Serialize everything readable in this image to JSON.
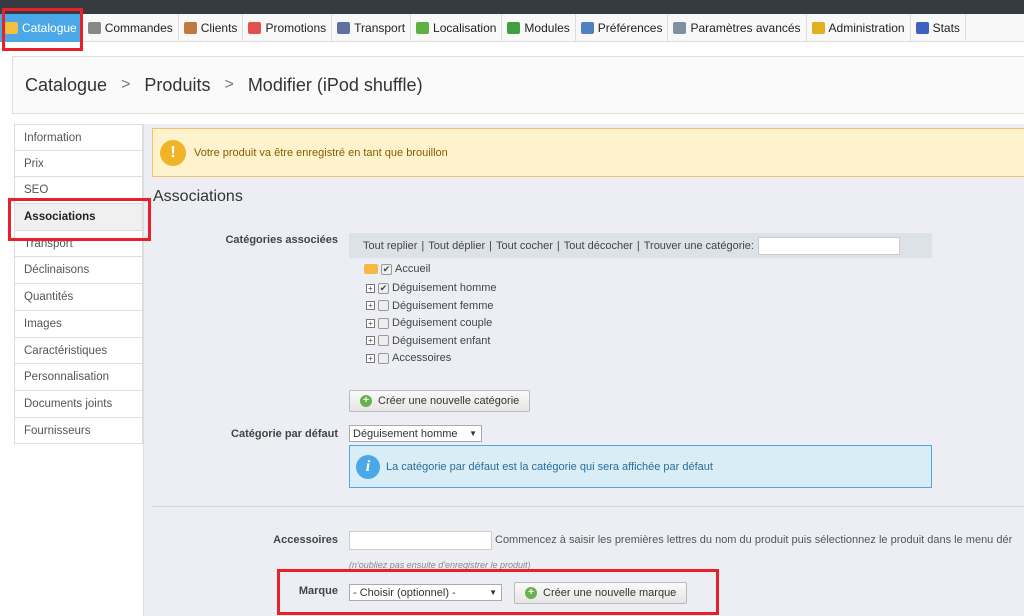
{
  "nav": {
    "tabs": [
      {
        "label": "Catalogue",
        "icon": "folder-icon",
        "color": "#f0c040",
        "active": true
      },
      {
        "label": "Commandes",
        "icon": "cart-icon",
        "color": "#888888"
      },
      {
        "label": "Clients",
        "icon": "user-icon",
        "color": "#c07a40"
      },
      {
        "label": "Promotions",
        "icon": "promotion-icon",
        "color": "#e05050"
      },
      {
        "label": "Transport",
        "icon": "truck-icon",
        "color": "#6070a0"
      },
      {
        "label": "Localisation",
        "icon": "globe-icon",
        "color": "#60b040"
      },
      {
        "label": "Modules",
        "icon": "puzzle-icon",
        "color": "#40a040"
      },
      {
        "label": "Préférences",
        "icon": "preferences-icon",
        "color": "#5080c0"
      },
      {
        "label": "Paramètres avancés",
        "icon": "wrench-icon",
        "color": "#8090a0"
      },
      {
        "label": "Administration",
        "icon": "key-icon",
        "color": "#e0b020"
      },
      {
        "label": "Stats",
        "icon": "chart-icon",
        "color": "#4060c0"
      }
    ]
  },
  "breadcrumb": {
    "items": [
      "Catalogue",
      "Produits",
      "Modifier (iPod shuffle)"
    ],
    "separator": ">"
  },
  "sidebar": {
    "items": [
      "Information",
      "Prix",
      "SEO",
      "Associations",
      "Transport",
      "Déclinaisons",
      "Quantités",
      "Images",
      "Caractéristiques",
      "Personnalisation",
      "Documents joints",
      "Fournisseurs"
    ],
    "selected": "Associations"
  },
  "warning": {
    "text": "Votre produit va être enregistré en tant que brouillon",
    "icon": "!"
  },
  "section_title": "Associations",
  "categories": {
    "label": "Catégories associées",
    "toolbar": [
      "Tout replier",
      "Tout déplier",
      "Tout cocher",
      "Tout décocher"
    ],
    "find_label": "Trouver une catégorie:",
    "find_value": "",
    "root": {
      "label": "Accueil",
      "checked": true
    },
    "children": [
      {
        "label": "Déguisement homme",
        "checked": true
      },
      {
        "label": "Déguisement femme",
        "checked": false
      },
      {
        "label": "Déguisement couple",
        "checked": false
      },
      {
        "label": "Déguisement enfant",
        "checked": false
      },
      {
        "label": "Accessoires",
        "checked": false
      }
    ],
    "create_button": "Créer une nouvelle catégorie"
  },
  "default_category": {
    "label": "Catégorie par défaut",
    "value": "Déguisement homme",
    "info": "La catégorie par défaut est la catégorie qui sera affichée par défaut",
    "info_icon": "i"
  },
  "accessories": {
    "label": "Accessoires",
    "value": "",
    "hint": "Commencez à saisir les premières lettres du nom du produit puis sélectionnez le produit dans le menu dér",
    "note": "(n'oubliez pas ensuite d'enregistrer le produit)"
  },
  "brand": {
    "label": "Marque",
    "value": "- Choisir (optionnel) -",
    "create_button": "Créer une nouvelle marque"
  },
  "highlight_color": "#e8202a"
}
